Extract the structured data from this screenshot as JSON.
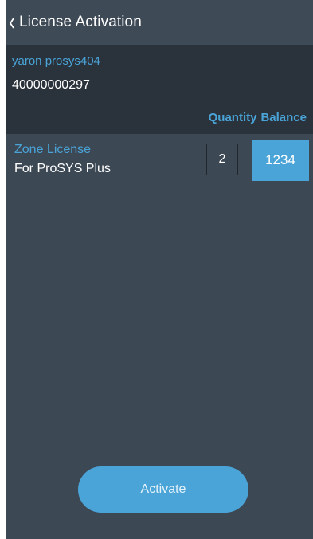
{
  "header": {
    "back_icon": "chevron-left-icon",
    "title": "License Activation"
  },
  "account": {
    "name": "yaron prosys404",
    "number": "40000000297"
  },
  "columns": {
    "quantity": "Quantity",
    "balance": "Balance"
  },
  "licenses": [
    {
      "name": "Zone License",
      "description": "For ProSYS Plus",
      "quantity": "2",
      "balance": "1234"
    }
  ],
  "actions": {
    "activate_label": "Activate"
  },
  "colors": {
    "background": "#3d4855",
    "account_panel": "#2a323c",
    "accent": "#4aa4d8"
  }
}
